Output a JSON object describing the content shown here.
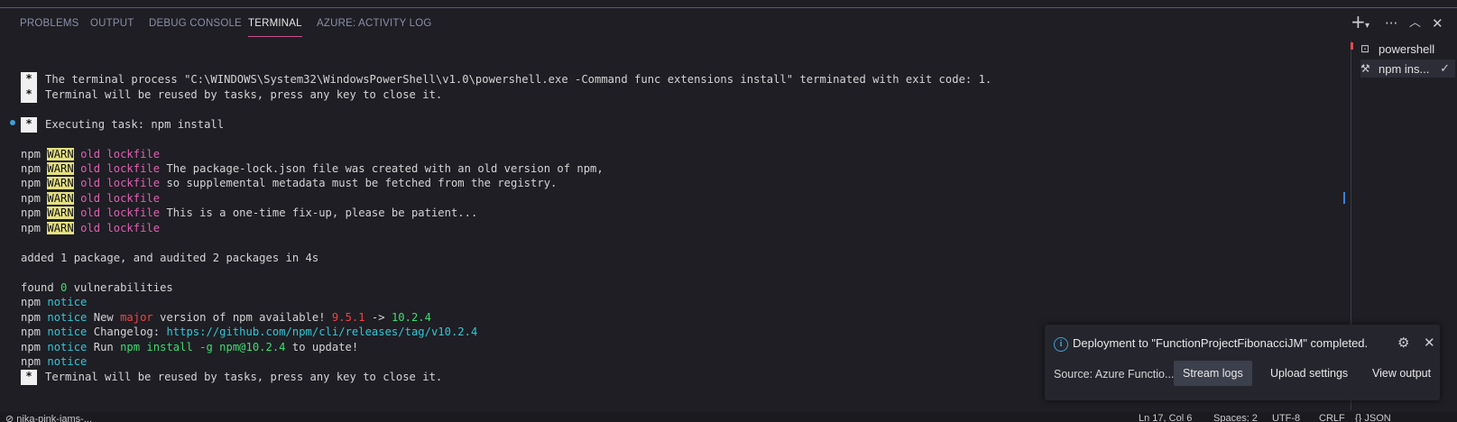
{
  "tabs": [
    {
      "label": "PROBLEMS",
      "active": false
    },
    {
      "label": "OUTPUT",
      "active": false
    },
    {
      "label": "DEBUG CONSOLE",
      "active": false
    },
    {
      "label": "TERMINAL",
      "active": true
    },
    {
      "label": "AZURE: ACTIVITY LOG",
      "active": false
    }
  ],
  "toolbar_icons": [
    "plus-icon",
    "chevron-down-icon",
    "ellipsis-icon",
    "chevron-up-icon",
    "close-icon"
  ],
  "terminal": {
    "line1": "The terminal process \"C:\\WINDOWS\\System32\\WindowsPowerShell\\v1.0\\powershell.exe -Command func extensions install\" terminated with exit code: 1.",
    "line2": "Terminal will be reused by tasks, press any key to close it.",
    "line3": "Executing task: npm install",
    "star": "*",
    "npm": "npm",
    "warn": "WARN",
    "old_lockfile": "old lockfile",
    "warn_msg_2": " The package-lock.json file was created with an old version of npm,",
    "warn_msg_3": " so supplemental metadata must be fetched from the registry.",
    "warn_msg_5": " This is a one-time fix-up, please be patient...",
    "added": "added 1 package, and audited 2 packages in 4s",
    "found_pre": "found ",
    "found_num": "0",
    "found_post": " vulnerabilities",
    "notice": "notice",
    "notice_new_pre": " New ",
    "major": "major",
    "notice_new_mid": " version of npm available! ",
    "old_ver": "9.5.1",
    "arrow": " -> ",
    "new_ver": "10.2.4",
    "changelog_pre": " Changelog: ",
    "changelog_url": "https://github.com/npm/cli/releases/tag/v10.2.4",
    "run_pre": " Run ",
    "run_cmd": "npm install -g npm@10.2.4",
    "run_post": " to update!",
    "last": "Terminal will be reused by tasks, press any key to close it."
  },
  "terminal_list": [
    {
      "label": "powershell",
      "icon": "terminal-icon"
    },
    {
      "label": "npm ins...",
      "icon": "tools-icon",
      "checked": true
    }
  ],
  "toast": {
    "message": "Deployment to \"FunctionProjectFibonacciJM\" completed.",
    "source": "Source: Azure Functio...",
    "buttons": [
      "Stream logs",
      "Upload settings",
      "View output"
    ]
  },
  "status_bar": {
    "left": "⊘ nika-pink-jams-...",
    "right_items": [
      "Ln 17, Col 6",
      "Spaces: 2",
      "UTF-8",
      "CRLF",
      "{} JSON"
    ]
  },
  "colors": {
    "accent": "#c94f8c",
    "info": "#3f9fd9",
    "warn_bg": "#e3df82",
    "magenta": "#e25fb4",
    "cyan": "#33c6d6",
    "green": "#3fdc6f"
  }
}
